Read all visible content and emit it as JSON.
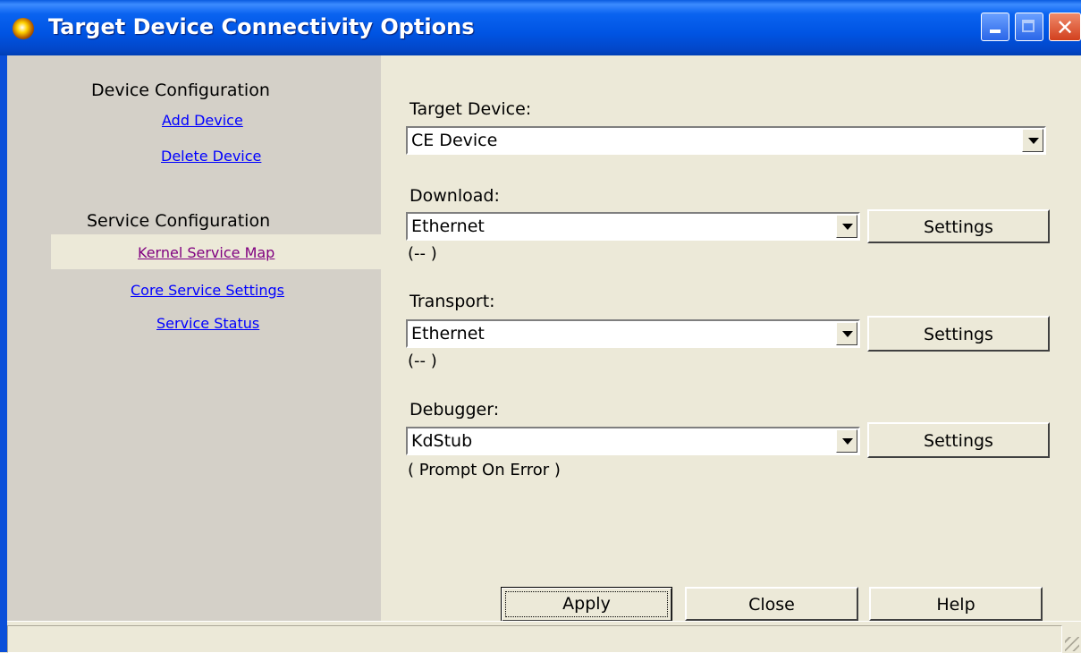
{
  "window": {
    "title": "Target Device Connectivity Options",
    "minimize_label": "minimize",
    "maximize_label": "maximize",
    "close_symbol": "✕"
  },
  "sidebar": {
    "device_heading": "Device Configuration",
    "add_device": "Add Device",
    "delete_device": "Delete Device",
    "service_heading": "Service Configuration",
    "kernel_service_map": "Kernel Service Map",
    "core_service_settings": "Core Service Settings",
    "service_status": "Service Status"
  },
  "main": {
    "target_device": {
      "label": "Target Device:",
      "value": "CE Device"
    },
    "download": {
      "label": "Download:",
      "value": "Ethernet",
      "status": "(-- )",
      "settings": "Settings"
    },
    "transport": {
      "label": "Transport:",
      "value": "Ethernet",
      "status": "(-- )",
      "settings": "Settings"
    },
    "debugger": {
      "label": "Debugger:",
      "value": "KdStub",
      "status": "( Prompt On Error )",
      "settings": "Settings"
    }
  },
  "footer": {
    "apply": "Apply",
    "close": "Close",
    "help": "Help"
  },
  "colors": {
    "titlebar": "#0054e3",
    "sidebar": "#d4d0c8",
    "face": "#ece9d8",
    "link": "#0000ff",
    "visited_link": "#800080"
  },
  "icons": [
    "app-icon",
    "minimize-icon",
    "maximize-icon",
    "close-icon",
    "chevron-down-icon",
    "resize-grip-icon"
  ]
}
